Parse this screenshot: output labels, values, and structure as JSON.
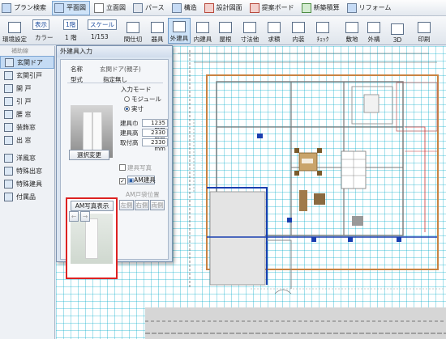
{
  "top_menu": [
    {
      "label": "プラン検索",
      "icon": "plan-search-icon"
    },
    {
      "label": "平面図",
      "icon": "floor-plan-icon",
      "active": true
    },
    {
      "label": "立面図",
      "icon": "elevation-icon"
    },
    {
      "label": "パース",
      "icon": "perspective-icon"
    },
    {
      "label": "構造",
      "icon": "structure-icon"
    },
    {
      "label": "設計図面",
      "icon": "drawing-icon"
    },
    {
      "label": "提案ボード",
      "icon": "proposal-board-icon"
    },
    {
      "label": "新築積算",
      "icon": "estimate-icon"
    },
    {
      "label": "リフォーム",
      "icon": "reform-icon"
    }
  ],
  "toolbar2": {
    "env_label": "環境設定",
    "display_label": "表示",
    "layer_label": "1階",
    "scale_label": "スケール",
    "color_label": "カラー",
    "floor_label": "1 階",
    "scale_value": "1/153",
    "buttons": [
      {
        "label": "間仕切",
        "icon": "partition-icon"
      },
      {
        "label": "器具",
        "icon": "fixture-icon"
      },
      {
        "label": "外建具",
        "icon": "exterior-fitting-icon",
        "active": true
      },
      {
        "label": "内建具",
        "icon": "interior-fitting-icon"
      },
      {
        "label": "屋根",
        "icon": "roof-icon"
      },
      {
        "label": "寸法他",
        "icon": "dimension-icon"
      },
      {
        "label": "求積",
        "icon": "area-icon"
      },
      {
        "label": "内装",
        "icon": "interior-icon"
      },
      {
        "label": "ﾁｪｯｸ",
        "icon": "check-icon"
      },
      {
        "label": "敷地",
        "icon": "site-icon"
      },
      {
        "label": "外構",
        "icon": "exterior-icon"
      },
      {
        "label": "3D",
        "icon": "3d-icon"
      },
      {
        "label": "印刷",
        "icon": "print-icon"
      }
    ]
  },
  "left_panel": {
    "header": "補助線",
    "items": [
      {
        "label": "玄関ドア",
        "active": true
      },
      {
        "label": "玄関引戸"
      },
      {
        "label": "開 戸"
      },
      {
        "label": "引 戸"
      },
      {
        "label": "腰 窓"
      },
      {
        "label": "装飾窓"
      },
      {
        "label": "出 窓"
      },
      {
        "label": "洋風窓"
      },
      {
        "label": "特殊出窓"
      },
      {
        "label": "特殊建具"
      },
      {
        "label": "付属品"
      }
    ]
  },
  "dialog": {
    "title": "外建具入力",
    "name_label": "名称",
    "name_value": "玄関ドア(親子)",
    "type_label": "型式",
    "type_value": "指定無し",
    "input_mode_label": "入力モード",
    "mode_options": [
      {
        "label": "モジュール",
        "selected": false
      },
      {
        "label": "実寸",
        "selected": true
      }
    ],
    "width_label": "建具巾",
    "width_value": "1235 mm",
    "height_label": "建具高",
    "height_value": "2330 mm",
    "sill_label": "取付高",
    "sill_value": "2330 mm",
    "select_change_button": "選択変更",
    "am_photo_label": "AM写真表示",
    "fitting_photo_label": "建具写真",
    "am_fitting_label": "AM建具",
    "am_door_position_label": "AM戸袋位置",
    "position_buttons": [
      "左側",
      "右側",
      "両側"
    ],
    "nav_prev": "←",
    "nav_next": "→"
  },
  "colors": {
    "accent": "#2a5ea8",
    "active_bg": "#cde2f7",
    "grid": "#00aac8",
    "wall_orange": "#c98342",
    "highlight_red": "#d22222"
  }
}
